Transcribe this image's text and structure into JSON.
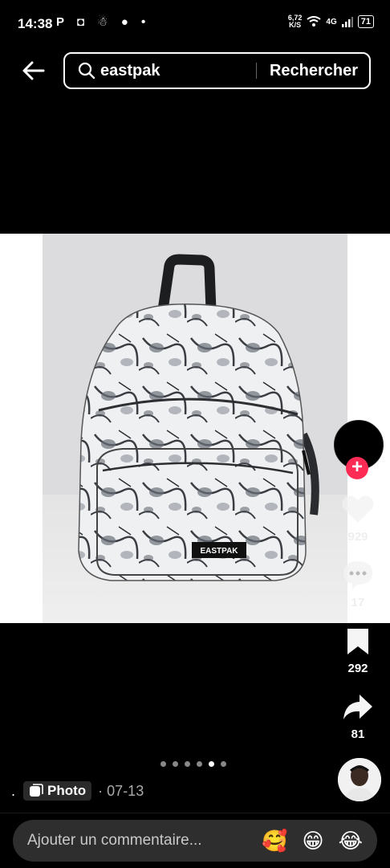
{
  "status": {
    "time": "14:38",
    "left_icons": "P ◘ ☃ ● •",
    "net_speed_value": "6,72",
    "net_speed_unit": "K/S",
    "network": "4G",
    "battery": "71"
  },
  "search": {
    "query": "eastpak",
    "submit_label": "Rechercher"
  },
  "post": {
    "likes": "929",
    "comments": "17",
    "saves": "292",
    "shares": "81",
    "follow_symbol": "+",
    "badge_label": "Photo",
    "date": "· 07-13",
    "leading_text": ".",
    "slide_count": 6,
    "active_slide": 5,
    "product_label": "EASTPAK"
  },
  "comment": {
    "placeholder": "Ajouter un commentaire...",
    "emojis": [
      "🥰",
      "😁",
      "😂"
    ]
  },
  "colors": {
    "accent": "#fe2c55",
    "background": "#000000"
  }
}
